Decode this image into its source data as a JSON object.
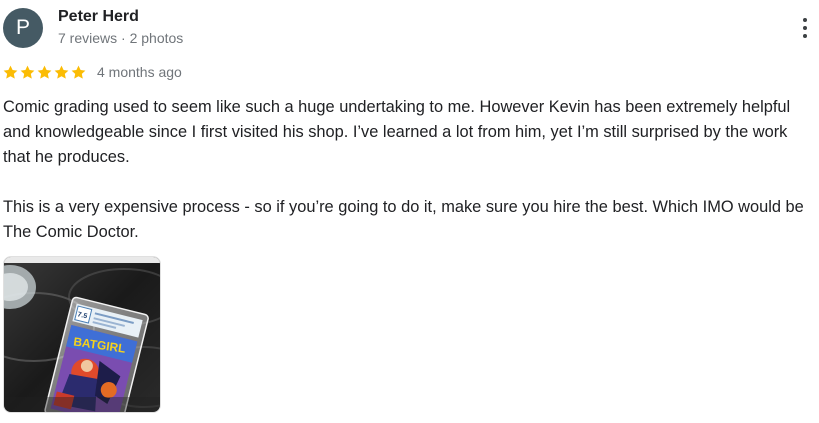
{
  "review": {
    "avatar_letter": "P",
    "avatar_color": "#455a64",
    "reviewer_name": "Peter Herd",
    "reviewer_meta": "7 reviews · 2 photos",
    "rating": 5,
    "rating_max": 5,
    "star_color": "#fbbc04",
    "date": "4 months ago",
    "paragraphs": [
      "Comic grading used to seem like such a huge undertaking to me. However Kevin has been extremely helpful and knowledgeable since I first visited his shop. I’ve learned a lot from him, yet I’m still surprised by the work that he produces.",
      "This is a very expensive process - so if you’re going to do it, make sure you hire the best. Which IMO would be The Comic Doctor."
    ],
    "photo": {
      "slab_grade": "7.5",
      "comic_title": "BATGIRL"
    }
  },
  "icons": {
    "more": "more-vert-icon",
    "star": "star-icon"
  }
}
